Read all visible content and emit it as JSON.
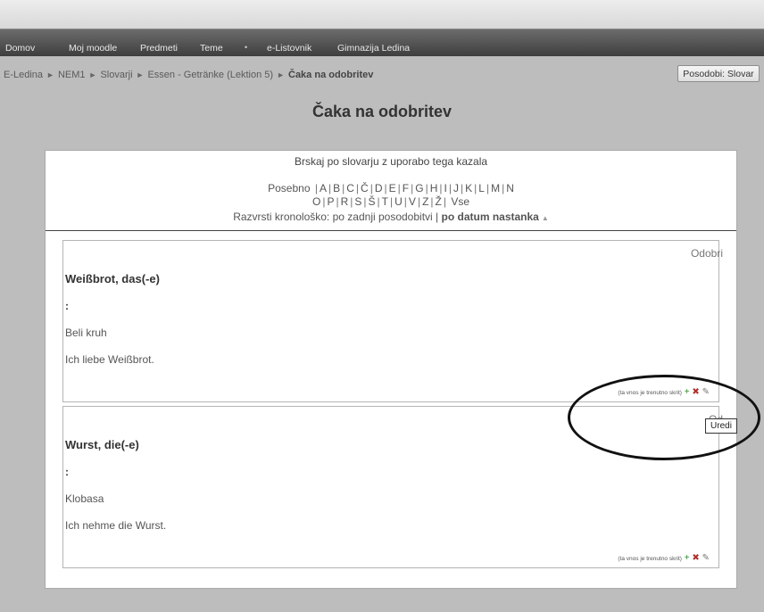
{
  "nav": {
    "items": [
      "Domov",
      "Moj moodle",
      "Predmeti",
      "Teme",
      "e-Listovnik",
      "Gimnazija Ledina"
    ],
    "dot": "•"
  },
  "breadcrumb": {
    "items": [
      "E-Ledina",
      "NEM1",
      "Slovarji",
      "Essen - Getränke (Lektion 5)",
      "Čaka na odobritev"
    ],
    "separator": "►"
  },
  "update_button": "Posodobi: Slovar",
  "page_title": "Čaka na odobritev",
  "browse": {
    "title": "Brskaj po slovarju z uporabo tega kazala",
    "special": "Posebno",
    "letters_row1": [
      "A",
      "B",
      "C",
      "Č",
      "D",
      "E",
      "F",
      "G",
      "H",
      "I",
      "J",
      "K",
      "L",
      "M",
      "N"
    ],
    "letters_row2": [
      "O",
      "P",
      "R",
      "S",
      "Š",
      "T",
      "U",
      "V",
      "Z",
      "Ž"
    ],
    "all": "Vse",
    "sort_label": "Razvrsti kronološko:",
    "sort_option1": "po zadnji posodobitvi",
    "sort_option2": "po datum nastanka",
    "sort_arrow": "▲"
  },
  "entries": [
    {
      "approve": "Odobri",
      "concept": "Weißbrot, das(-e)",
      "colon": ":",
      "definition1": "Beli kruh",
      "definition2": "Ich liebe Weißbrot.",
      "footer_text": "(ta vnos je trenutno skrit)"
    },
    {
      "approve": "Od",
      "concept": "Wurst, die(-e)",
      "colon": ":",
      "definition1": "Klobasa",
      "definition2": "Ich nehme die Wurst.",
      "footer_text": "(ta vnos je trenutno skrit)"
    }
  ],
  "icons": {
    "add": "+",
    "delete": "✖",
    "edit": "✎"
  },
  "tooltip": "Uredi"
}
